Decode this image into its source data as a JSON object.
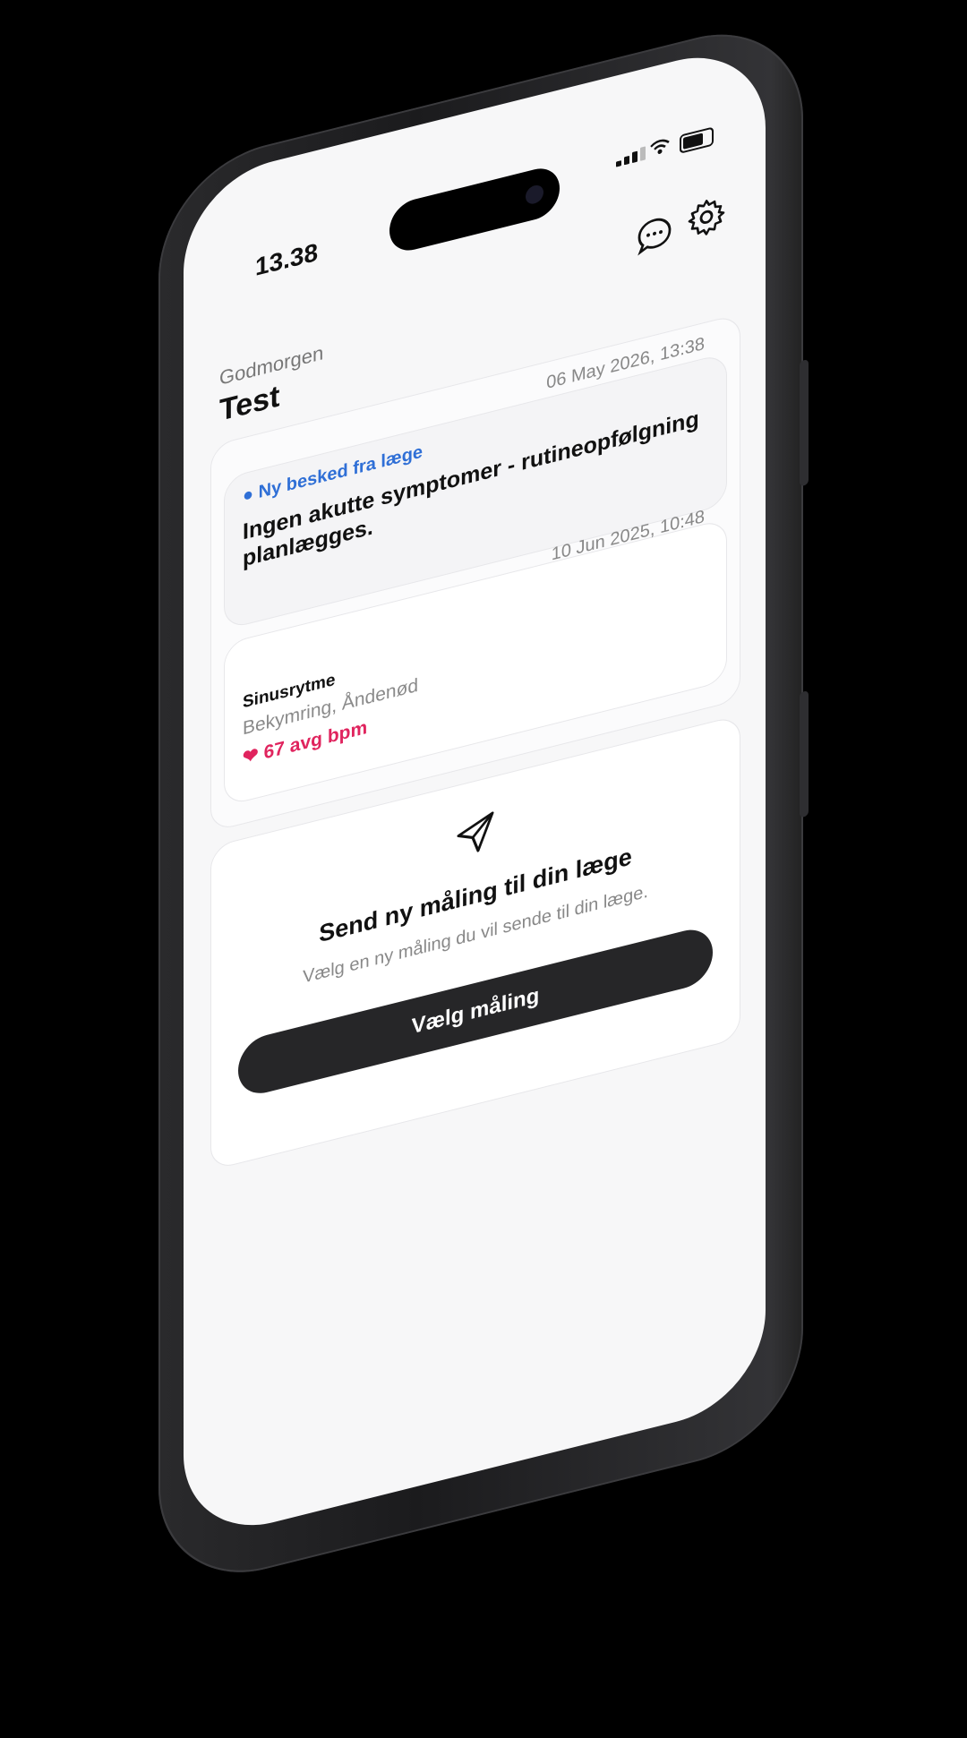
{
  "status_bar": {
    "time": "13.38"
  },
  "header": {
    "greeting": "Godmorgen",
    "user_name": "Test"
  },
  "message": {
    "date": "06 May 2026, 13:38",
    "badge": "Ny besked fra læge",
    "text": "Ingen akutte symptomer - rutineopfølgning planlægges."
  },
  "measurement": {
    "date": "10 Jun 2025, 10:48",
    "title": "Sinusrytme",
    "symptoms": "Bekymring, Åndenød",
    "heart_rate": "67 avg bpm"
  },
  "send_card": {
    "title": "Send ny måling til din læge",
    "subtitle": "Vælg en ny måling du vil sende til din læge.",
    "button": "Vælg måling"
  },
  "colors": {
    "accent_blue": "#2f6fd6",
    "heart_red": "#e0245e",
    "button_dark": "#262628"
  },
  "icons": [
    "chat-icon",
    "gear-icon",
    "send-icon",
    "heart-icon",
    "wifi-icon",
    "battery-icon",
    "signal-icon"
  ]
}
